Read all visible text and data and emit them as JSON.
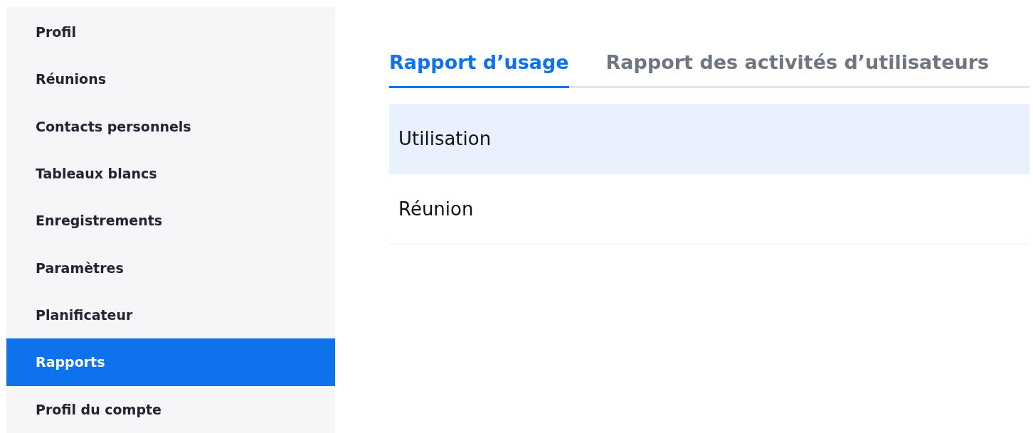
{
  "sidebar": {
    "items": [
      {
        "label": "Profil",
        "selected": false
      },
      {
        "label": "Réunions",
        "selected": false
      },
      {
        "label": "Contacts personnels",
        "selected": false
      },
      {
        "label": "Tableaux blancs",
        "selected": false
      },
      {
        "label": "Enregistrements",
        "selected": false
      },
      {
        "label": "Paramètres",
        "selected": false
      },
      {
        "label": "Planificateur",
        "selected": false
      },
      {
        "label": "Rapports",
        "selected": true
      },
      {
        "label": "Profil du compte",
        "selected": false
      }
    ]
  },
  "tabs": [
    {
      "label": "Rapport d’usage",
      "selected": true
    },
    {
      "label": "Rapport des activités d’utilisateurs",
      "selected": false
    }
  ],
  "report_list": [
    {
      "label": "Utilisation",
      "selected": true
    },
    {
      "label": "Réunion",
      "selected": false
    }
  ]
}
